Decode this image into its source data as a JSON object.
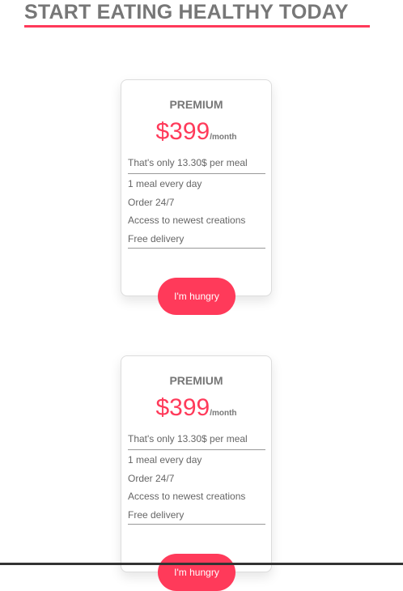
{
  "header": {
    "title": "START EATING HEALTHY TODAY"
  },
  "colors": {
    "accent": "#ff3a5a",
    "text": "#777777"
  },
  "plans": [
    {
      "name": "PREMIUM",
      "price": "$399",
      "period": "/month",
      "per_meal": "That's only 13.30$ per meal",
      "features": [
        "1 meal every day",
        "Order 24/7",
        "Access to newest creations",
        "Free delivery"
      ],
      "cta_label": "I'm hungry"
    },
    {
      "name": "PREMIUM",
      "price": "$399",
      "period": "/month",
      "per_meal": "That's only 13.30$ per meal",
      "features": [
        "1 meal every day",
        "Order 24/7",
        "Access to newest creations",
        "Free delivery"
      ],
      "cta_label": "I'm hungry"
    }
  ]
}
